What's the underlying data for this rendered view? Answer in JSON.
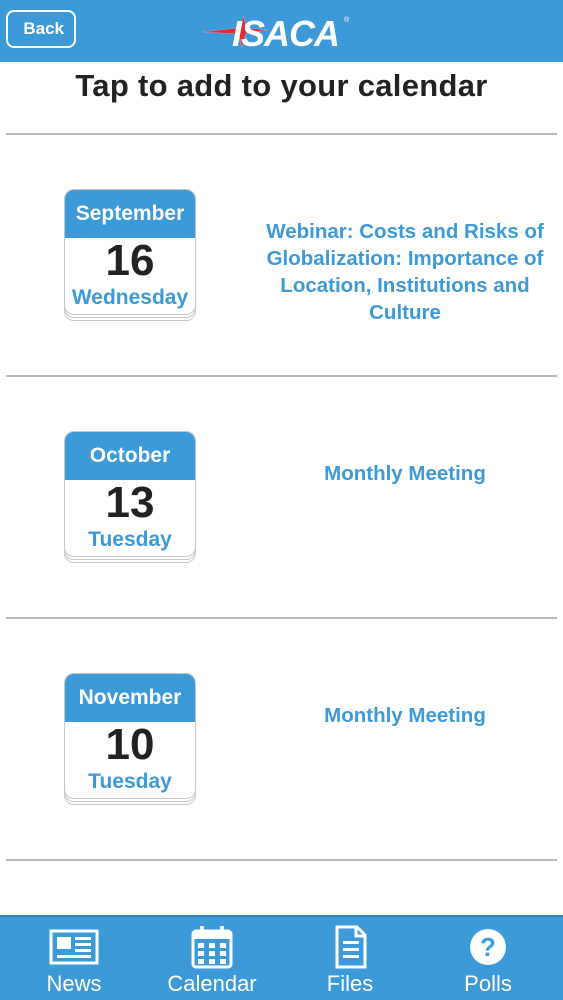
{
  "header": {
    "back_label": "Back",
    "logo_text": "ISACA",
    "bg_color": "#3d9ad8"
  },
  "subtitle": "Tap to add to your calendar",
  "events": [
    {
      "month": "September",
      "day": "16",
      "weekday": "Wednesday",
      "title_lines": [
        "Webinar: Costs and Risks of",
        "Globalization: Importance of",
        "Location, Institutions and",
        "Culture"
      ]
    },
    {
      "month": "October",
      "day": "13",
      "weekday": "Tuesday",
      "title_lines": [
        "Monthly Meeting"
      ]
    },
    {
      "month": "November",
      "day": "10",
      "weekday": "Tuesday",
      "title_lines": [
        "Monthly Meeting"
      ]
    }
  ],
  "tabs": [
    {
      "label": "News",
      "icon": "newspaper-icon"
    },
    {
      "label": "Calendar",
      "icon": "calendar-icon"
    },
    {
      "label": "Files",
      "icon": "document-icon"
    },
    {
      "label": "Polls",
      "icon": "question-circle-icon"
    }
  ],
  "colors": {
    "accent": "#3d9ad8",
    "text": "#222222",
    "divider": "#b8b8b8"
  }
}
